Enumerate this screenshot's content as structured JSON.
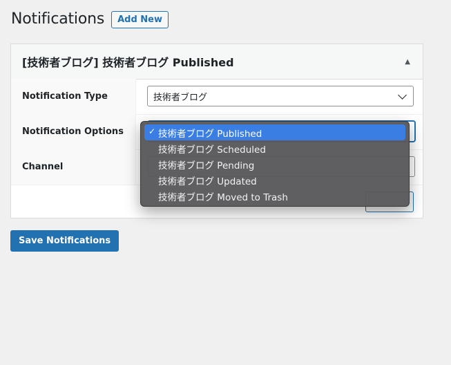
{
  "header": {
    "title": "Notifications",
    "add_new_label": "Add New"
  },
  "panel": {
    "title": "[技術者ブログ] 技術者ブログ Published",
    "rows": [
      {
        "label": "Notification Type",
        "value": "技術者ブログ"
      },
      {
        "label": "Notification Options",
        "value": "技術者ブログ Published"
      },
      {
        "label": "Channel",
        "value": ""
      }
    ]
  },
  "dropdown": {
    "selected_index": 0,
    "check_glyph": "✓",
    "options": [
      "技術者ブログ Published",
      "技術者ブログ Scheduled",
      "技術者ブログ Pending",
      "技術者ブログ Updated",
      "技術者ブログ Moved to Trash"
    ]
  },
  "footer": {
    "save_label": "Save Notifications"
  },
  "colors": {
    "accent": "#2271b1",
    "menu_highlight": "#3a7de3",
    "menu_bg": "#58585c"
  }
}
